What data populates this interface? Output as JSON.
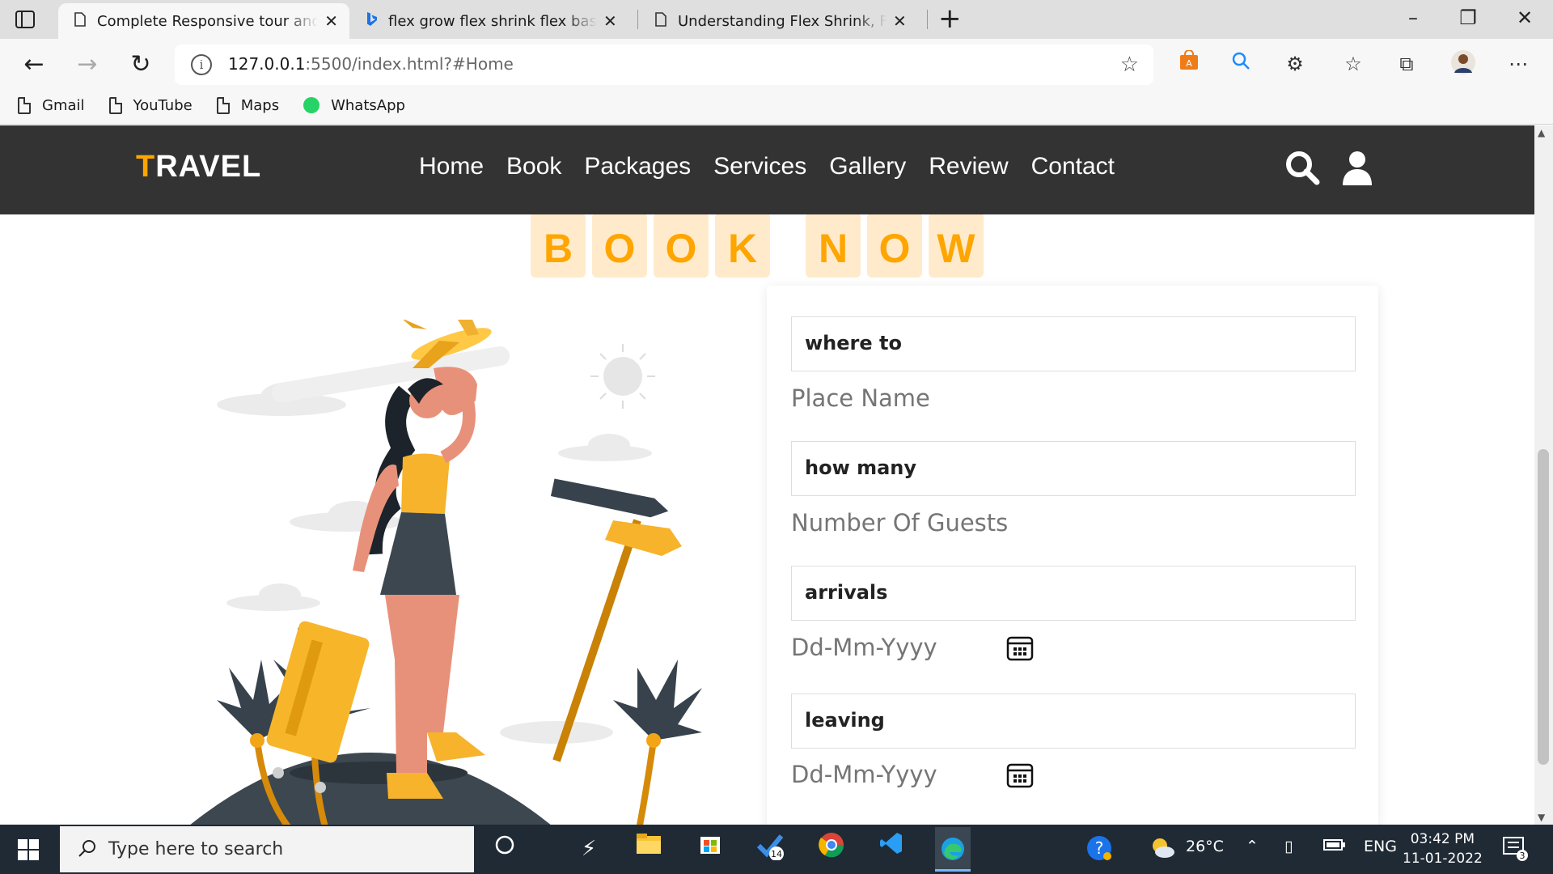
{
  "browser": {
    "tabs": [
      {
        "title": "Complete Responsive tour and travel",
        "active": true
      },
      {
        "title": "flex grow flex shrink flex basis - Bing",
        "active": false
      },
      {
        "title": "Understanding Flex Shrink, Flex Grow",
        "active": false
      }
    ],
    "url_host": "127.0.0.1",
    "url_rest": ":5500/index.html?#Home",
    "bookmarks": [
      "Gmail",
      "YouTube",
      "Maps",
      "WhatsApp"
    ],
    "accent": "#ffa500"
  },
  "site": {
    "logo_first": "T",
    "logo_rest": "RAVEL",
    "nav": [
      "Home",
      "Book",
      "Packages",
      "Services",
      "Gallery",
      "Review",
      "Contact"
    ],
    "heading_letters": [
      "B",
      "O",
      "O",
      "K",
      "",
      "N",
      "O",
      "W"
    ]
  },
  "form": {
    "fields": [
      {
        "label": "where to",
        "placeholder": "Place Name"
      },
      {
        "label": "how many",
        "placeholder": "Number Of Guests"
      },
      {
        "label": "arrivals",
        "placeholder": "Dd-Mm-Yyyy"
      },
      {
        "label": "leaving",
        "placeholder": "Dd-Mm-Yyyy"
      }
    ]
  },
  "taskbar": {
    "search_placeholder": "Type here to search",
    "badge_count": "14",
    "temperature": "26°C",
    "language": "ENG",
    "time": "03:42 PM",
    "date": "11-01-2022",
    "notifications": "3"
  }
}
